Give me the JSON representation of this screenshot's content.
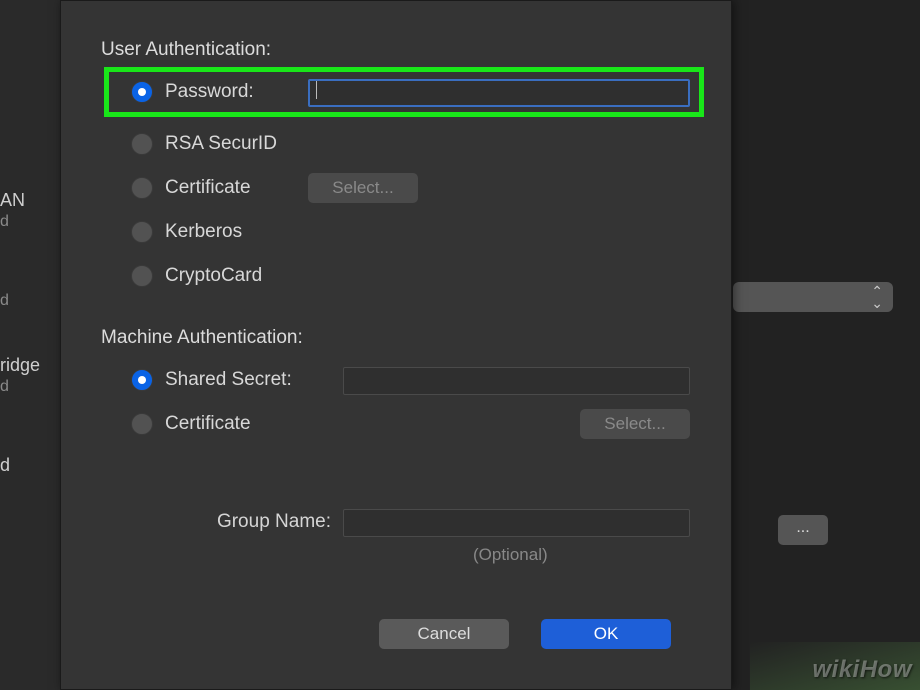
{
  "sidebar": {
    "items": [
      {
        "main": "AN",
        "sub": "d"
      },
      {
        "main": "",
        "sub": "d"
      },
      {
        "main": "ridge",
        "sub": "d"
      },
      {
        "main": "d",
        "sub": ""
      }
    ]
  },
  "dialog": {
    "user_auth": {
      "title": "User Authentication:",
      "options": {
        "password": {
          "label": "Password:",
          "value": ""
        },
        "rsa": {
          "label": "RSA SecurID"
        },
        "cert": {
          "label": "Certificate",
          "select_button": "Select..."
        },
        "kerberos": {
          "label": "Kerberos"
        },
        "cryptocard": {
          "label": "CryptoCard"
        }
      }
    },
    "machine_auth": {
      "title": "Machine Authentication:",
      "options": {
        "shared_secret": {
          "label": "Shared Secret:",
          "value": ""
        },
        "cert": {
          "label": "Certificate",
          "select_button": "Select..."
        }
      }
    },
    "group_name": {
      "label": "Group Name:",
      "value": "",
      "hint": "(Optional)"
    },
    "buttons": {
      "cancel": "Cancel",
      "ok": "OK"
    }
  },
  "bg": {
    "more_button": "..."
  },
  "watermark": "wikiHow"
}
